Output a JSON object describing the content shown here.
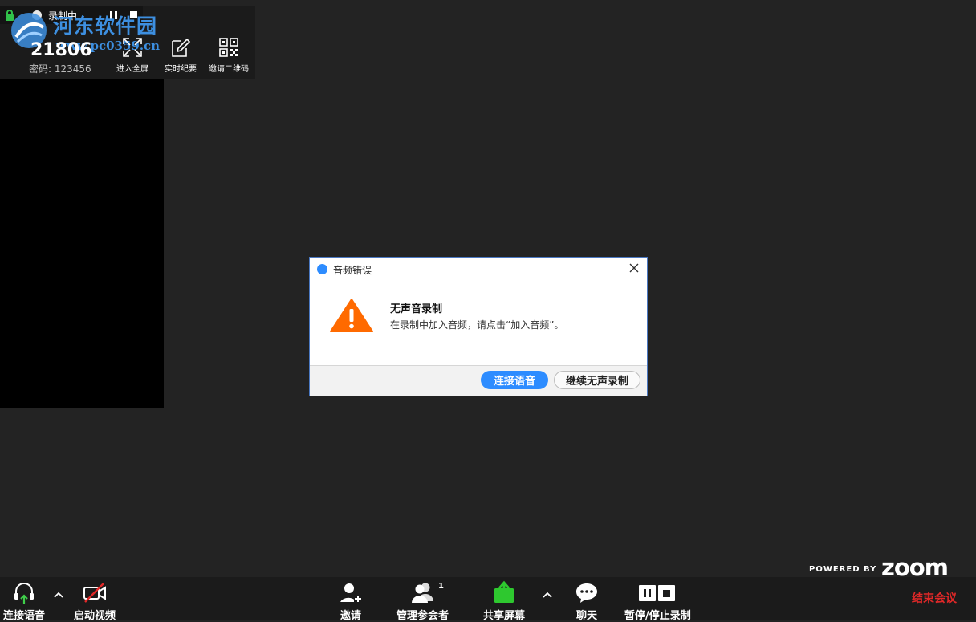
{
  "colors": {
    "accent": "#2d8cff",
    "end_red": "#e02828",
    "warning_orange": "#ff6a00",
    "background": "#232323"
  },
  "recording_bar": {
    "status": "录制中..."
  },
  "watermark": {
    "name": "河东软件园",
    "url": "www.pc0359.cn"
  },
  "meeting_info": {
    "id": "21806",
    "password": "密码: 123456"
  },
  "top_tools": [
    {
      "label": "进入全屏",
      "icon": "fullscreen-icon"
    },
    {
      "label": "实时纪要",
      "icon": "notes-edit-icon"
    },
    {
      "label": "邀请二维码",
      "icon": "qr-code-icon"
    }
  ],
  "dialog": {
    "title": "音频错误",
    "heading": "无声音录制",
    "message": "在录制中加入音频，请点击“加入音频”。",
    "primary_button": "连接语音",
    "secondary_button": "继续无声录制"
  },
  "branding": {
    "powered_by": "POWERED BY",
    "logo": "zoom"
  },
  "toolbar": {
    "audio": "连接语音",
    "video": "启动视频",
    "invite": "邀请",
    "participants": "管理参会者",
    "participants_count": "1",
    "share": "共享屏幕",
    "chat": "聊天",
    "record": "暂停/停止录制",
    "end": "结束会议"
  }
}
